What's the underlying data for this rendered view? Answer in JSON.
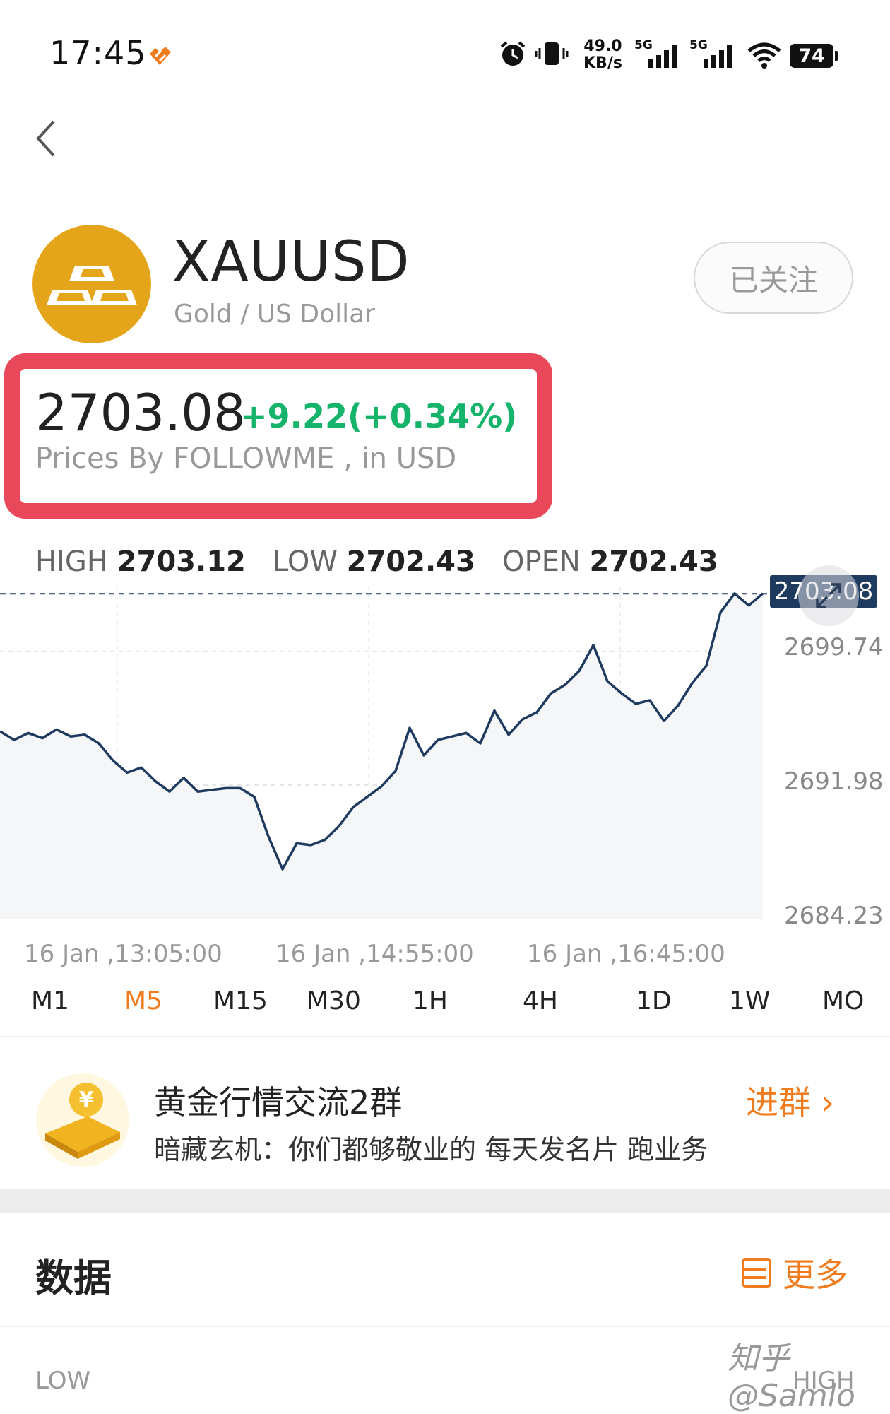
{
  "status_bar": {
    "time": "17:45",
    "speed_value": "49.0",
    "speed_unit": "KB/s",
    "net1": "5G",
    "net2": "5G",
    "battery": "74"
  },
  "header": {
    "back_icon": "chevron-left-icon"
  },
  "instrument": {
    "symbol": "XAUUSD",
    "name": "Gold / US Dollar",
    "follow_label": "已关注",
    "logo_icon": "gold-bars-icon",
    "logo_color": "#E5A51B"
  },
  "quote": {
    "price": "2703.08",
    "change": "+9.22(+0.34%)",
    "source": "Prices By FOLLOWME , in USD",
    "change_color": "#16B46B",
    "highlight_color": "#E8485A"
  },
  "stats": {
    "high_label": "HIGH",
    "high_value": "2703.12",
    "low_label": "LOW",
    "low_value": "2702.43",
    "open_label": "OPEN",
    "open_value": "2702.43"
  },
  "chart_data": {
    "type": "line",
    "x_labels": [
      "16 Jan ,13:05:00",
      "16 Jan ,14:55:00",
      "16 Jan ,16:45:00"
    ],
    "y_ticks": [
      "2699.74",
      "2691.98",
      "2684.23"
    ],
    "ylim": [
      2684.23,
      2703.5
    ],
    "current_price": "2703.08",
    "grid": true,
    "line_color": "#1E3A5F",
    "values": [
      2695.1,
      2694.6,
      2695.0,
      2694.7,
      2695.2,
      2694.8,
      2694.9,
      2694.4,
      2693.4,
      2692.7,
      2693.0,
      2692.2,
      2691.6,
      2692.4,
      2691.6,
      2691.7,
      2691.8,
      2691.8,
      2691.3,
      2689.0,
      2687.1,
      2688.6,
      2688.5,
      2688.8,
      2689.6,
      2690.7,
      2691.3,
      2691.9,
      2692.8,
      2695.3,
      2693.7,
      2694.6,
      2694.8,
      2695.0,
      2694.4,
      2696.3,
      2694.9,
      2695.8,
      2696.2,
      2697.3,
      2697.8,
      2698.6,
      2700.1,
      2698.0,
      2697.3,
      2696.7,
      2696.9,
      2695.7,
      2696.6,
      2697.9,
      2698.9,
      2702.0,
      2703.1,
      2702.4,
      2703.1
    ]
  },
  "timeframes": {
    "items": [
      "M1",
      "M5",
      "M15",
      "M30",
      "1H",
      "4H",
      "1D",
      "1W",
      "MO"
    ],
    "active": "M5",
    "active_color": "#F07C1E"
  },
  "group": {
    "title": "黄金行情交流2群",
    "message": "暗藏玄机：你们都够敬业的 每天发名片 跑业务",
    "join_label": "进群 ›"
  },
  "data_section": {
    "title": "数据",
    "more_label": "更多",
    "low_label": "LOW",
    "high_label": "HIGH"
  },
  "watermark": "知乎 @Samlo"
}
